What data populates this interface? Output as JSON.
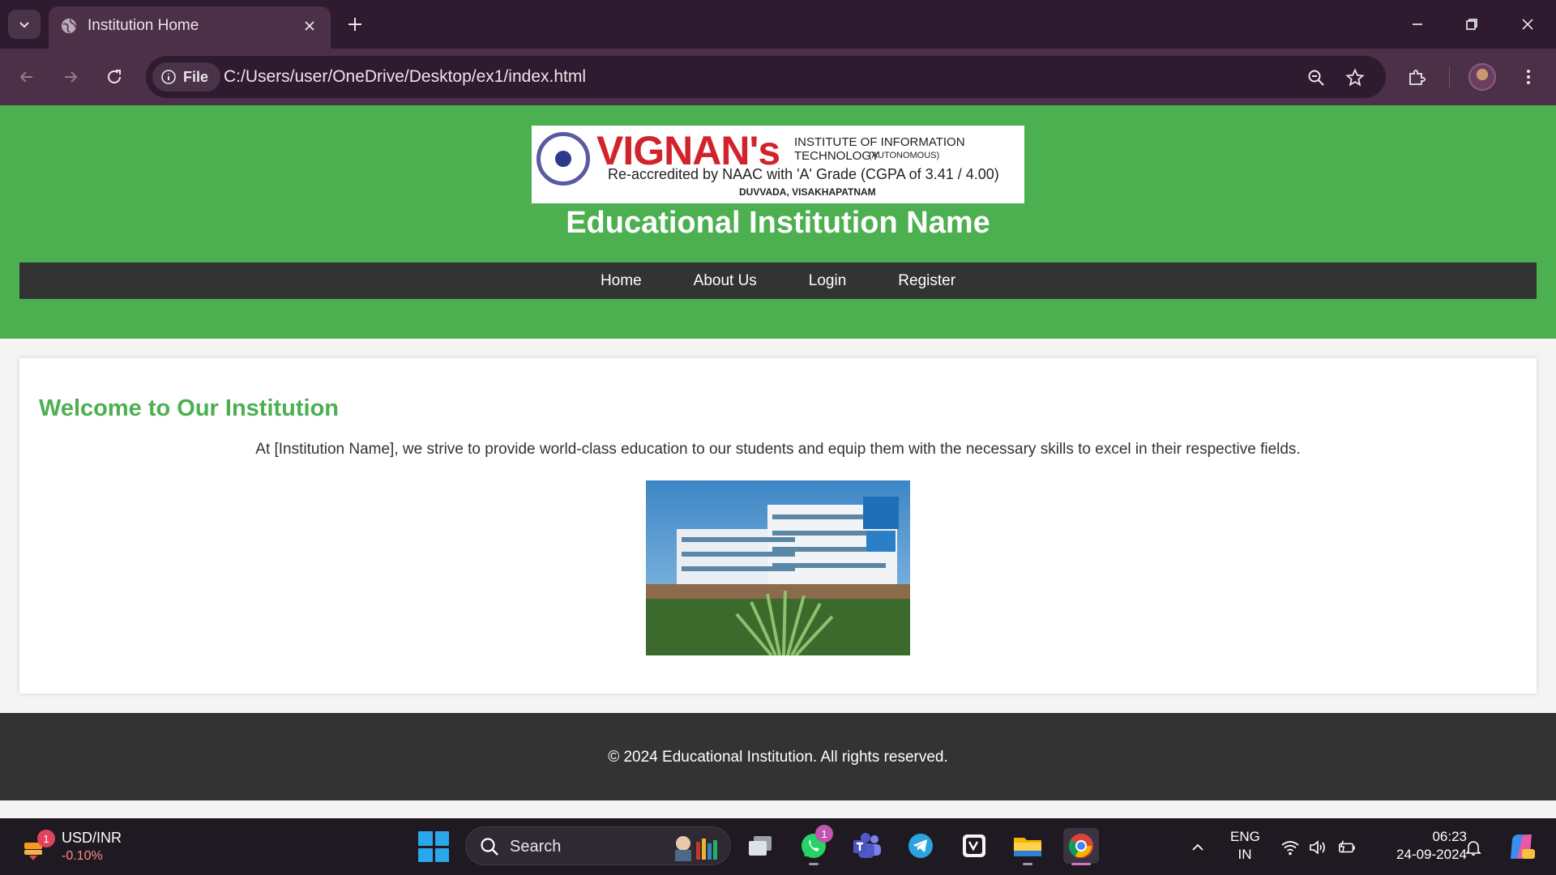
{
  "browser": {
    "tab": {
      "title": "Institution Home"
    },
    "omnibox": {
      "site_chip": "File",
      "url": "C:/Users/user/OneDrive/Desktop/ex1/index.html"
    }
  },
  "header": {
    "logo": {
      "brand": "VIGNAN's",
      "institute": "INSTITUTE OF INFORMATION TECHNOLOGY",
      "autonomous": "(AUTONOMOUS)",
      "accreditation": "Re-accredited by NAAC with 'A' Grade (CGPA of 3.41 / 4.00)",
      "place": "DUVVADA, VISAKHAPATNAM"
    },
    "title": "Educational Institution Name",
    "nav": {
      "items": [
        "Home",
        "About Us",
        "Login",
        "Register"
      ]
    }
  },
  "main": {
    "heading": "Welcome to Our Institution",
    "intro": "At [Institution Name], we strive to provide world-class education to our students and equip them with the necessary skills to excel in their respective fields."
  },
  "footer": {
    "text": "© 2024 Educational Institution. All rights reserved."
  },
  "taskbar": {
    "widget": {
      "label": "USD/INR",
      "value": "-0.10%",
      "badge": "1"
    },
    "search": {
      "label": "Search"
    },
    "whatsapp_badge": "1",
    "lang": {
      "line1": "ENG",
      "line2": "IN"
    },
    "clock": {
      "time": "06:23",
      "date": "24-09-2024"
    }
  },
  "colors": {
    "brand_green": "#4caf50",
    "nav_dark": "#333333",
    "browser_frame": "#4b3047"
  }
}
